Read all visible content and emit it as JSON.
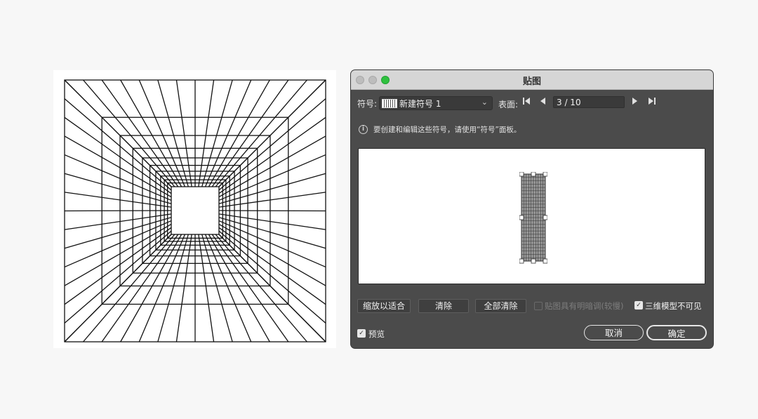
{
  "dialog": {
    "title": "贴图",
    "symbol_label": "符号:",
    "symbol_value": "新建符号 1",
    "surface_label": "表面:",
    "surface_value": "3 / 10",
    "info_text": "要创建和编辑这些符号，请使用“符号”面板。",
    "buttons": {
      "fit": "缩放以适合",
      "clear": "清除",
      "clear_all": "全部清除",
      "cancel": "取消",
      "ok": "确定"
    },
    "checkboxes": {
      "shade_artwork": {
        "label": "贴图具有明暗调(较慢)",
        "checked": false,
        "enabled": false
      },
      "invisible_geometry": {
        "label": "三维模型不可见",
        "checked": true
      },
      "preview": {
        "label": "预览",
        "checked": true
      }
    },
    "accent_color": "#2fc13f"
  },
  "icons": {
    "first": "⏮",
    "prev": "◀",
    "next": "▶",
    "last": "⏭",
    "info": "i",
    "chevron": "⌄",
    "check": "✓"
  }
}
